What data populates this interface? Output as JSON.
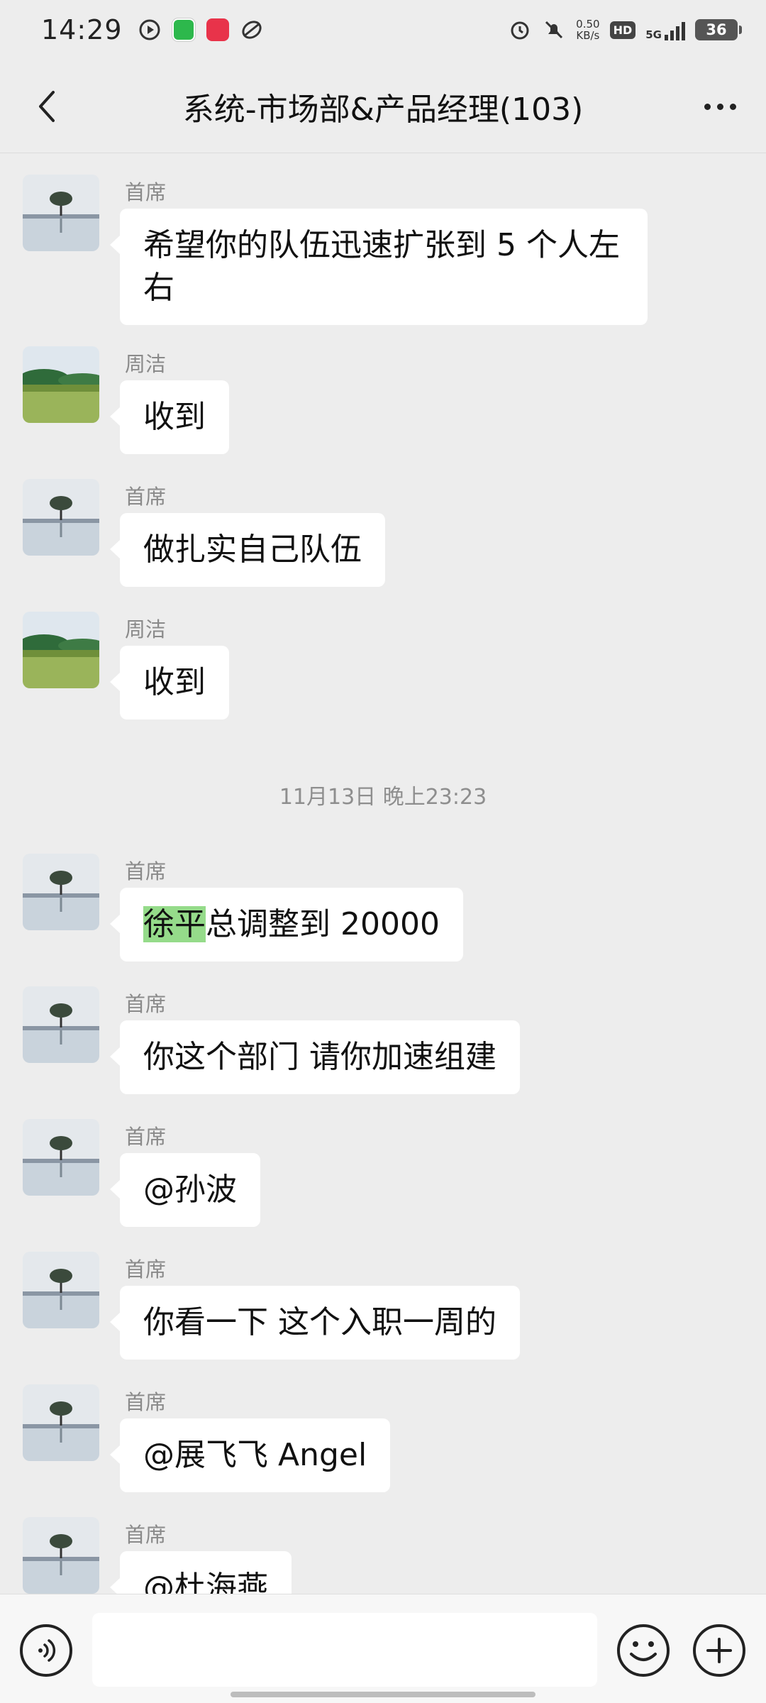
{
  "status_bar": {
    "time": "14:29",
    "apps": [
      "play-circle-icon",
      "app-icon-green",
      "app-icon-red",
      "app-icon-gray"
    ],
    "net_speed_value": "0.50",
    "net_speed_unit": "KB/s",
    "hd_label": "HD",
    "network_label": "5G",
    "battery": "36"
  },
  "header": {
    "title": "系统-市场部&产品经理(103)"
  },
  "messages": [
    {
      "sender": "首席",
      "text": "希望你的队伍迅速扩张到 5 个人左右",
      "avatar": "tree-lake"
    },
    {
      "sender": "周洁",
      "text": "收到",
      "avatar": "green-lake"
    },
    {
      "sender": "首席",
      "text": "做扎实自己队伍",
      "avatar": "tree-lake"
    },
    {
      "sender": "周洁",
      "text": "收到",
      "avatar": "green-lake"
    },
    {
      "sender": "首席",
      "text_highlight": "徐平",
      "text_rest": "总调整到 20000",
      "avatar": "tree-lake"
    },
    {
      "sender": "首席",
      "text": "你这个部门 请你加速组建",
      "avatar": "tree-lake"
    },
    {
      "sender": "首席",
      "text": "@孙波",
      "avatar": "tree-lake"
    },
    {
      "sender": "首席",
      "text": "你看一下 这个入职一周的",
      "avatar": "tree-lake"
    },
    {
      "sender": "首席",
      "text": "@展飞飞 Angel",
      "avatar": "tree-lake"
    },
    {
      "sender": "首席",
      "text": "@杜海燕",
      "avatar": "tree-lake"
    }
  ],
  "time_separator": "11月13日 晚上23:23",
  "input_bar": {
    "placeholder": "",
    "icons": [
      "voice-icon",
      "emoji-icon",
      "plus-icon"
    ]
  },
  "colors": {
    "background": "#ededed",
    "bubble": "#ffffff",
    "highlight": "#95db8a",
    "sender_text": "#8a8a8a"
  }
}
